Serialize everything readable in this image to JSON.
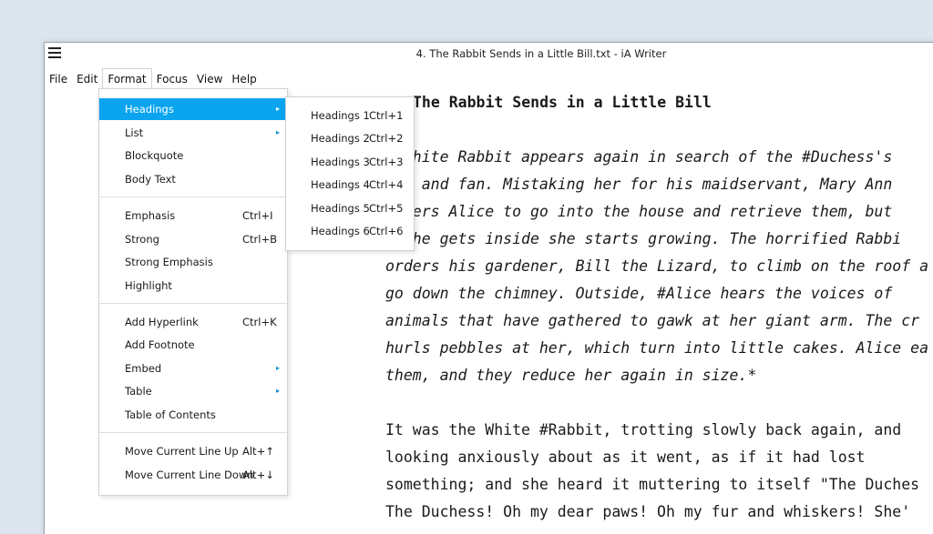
{
  "window": {
    "title": "4. The Rabbit Sends in a Little Bill.txt - iA Writer"
  },
  "menubar": [
    "File",
    "Edit",
    "Format",
    "Focus",
    "View",
    "Help"
  ],
  "document": {
    "heading": "The Rabbit Sends in a Little Bill",
    "italic_lines": [
      "e White Rabbit appears again in search of the #Duchess's",
      "ves and fan. Mistaking her for his maidservant, Mary Ann",
      "orders Alice to go into the house and retrieve them, but",
      "e she gets inside she starts growing. The horrified Rabbi",
      "orders his gardener, Bill the Lizard, to climb on the roof a",
      "go down the chimney. Outside, #Alice hears the voices of",
      "animals that have gathered to gawk at her giant arm. The cr",
      "hurls pebbles at her, which turn into little cakes. Alice ea",
      "them, and they reduce her again in size.*"
    ],
    "lines": [
      "It was the White #Rabbit, trotting slowly back again, and",
      "looking anxiously about as it went, as if it had lost",
      "something; and she heard it muttering to itself \"The Duches",
      "The Duchess! Oh my dear paws! Oh my fur and whiskers! She'"
    ]
  },
  "format_menu": {
    "group1": [
      {
        "label": "Headings",
        "arrow": "▸"
      },
      {
        "label": "List",
        "arrow": "▸"
      },
      {
        "label": "Blockquote"
      },
      {
        "label": "Body Text"
      }
    ],
    "group2": [
      {
        "label": "Emphasis",
        "shortcut": "Ctrl+I"
      },
      {
        "label": "Strong",
        "shortcut": "Ctrl+B"
      },
      {
        "label": "Strong Emphasis"
      },
      {
        "label": "Highlight"
      }
    ],
    "group3": [
      {
        "label": "Add Hyperlink",
        "shortcut": "Ctrl+K"
      },
      {
        "label": "Add Footnote"
      },
      {
        "label": "Embed",
        "arrow": "▸"
      },
      {
        "label": "Table",
        "arrow": "▸"
      },
      {
        "label": "Table of Contents"
      }
    ],
    "group4": [
      {
        "label": "Move Current Line Up",
        "shortcut": "Alt+↑"
      },
      {
        "label": "Move Current Line Down",
        "shortcut": "Alt+↓"
      }
    ]
  },
  "headings_submenu": [
    {
      "label": "Headings 1",
      "shortcut": "Ctrl+1"
    },
    {
      "label": "Headings 2",
      "shortcut": "Ctrl+2"
    },
    {
      "label": "Headings 3",
      "shortcut": "Ctrl+3"
    },
    {
      "label": "Headings 4",
      "shortcut": "Ctrl+4"
    },
    {
      "label": "Headings 5",
      "shortcut": "Ctrl+5"
    },
    {
      "label": "Headings 6",
      "shortcut": "Ctrl+6"
    }
  ],
  "colors": {
    "accent": "#0aa4ef",
    "desktop": "#dde6ee"
  }
}
